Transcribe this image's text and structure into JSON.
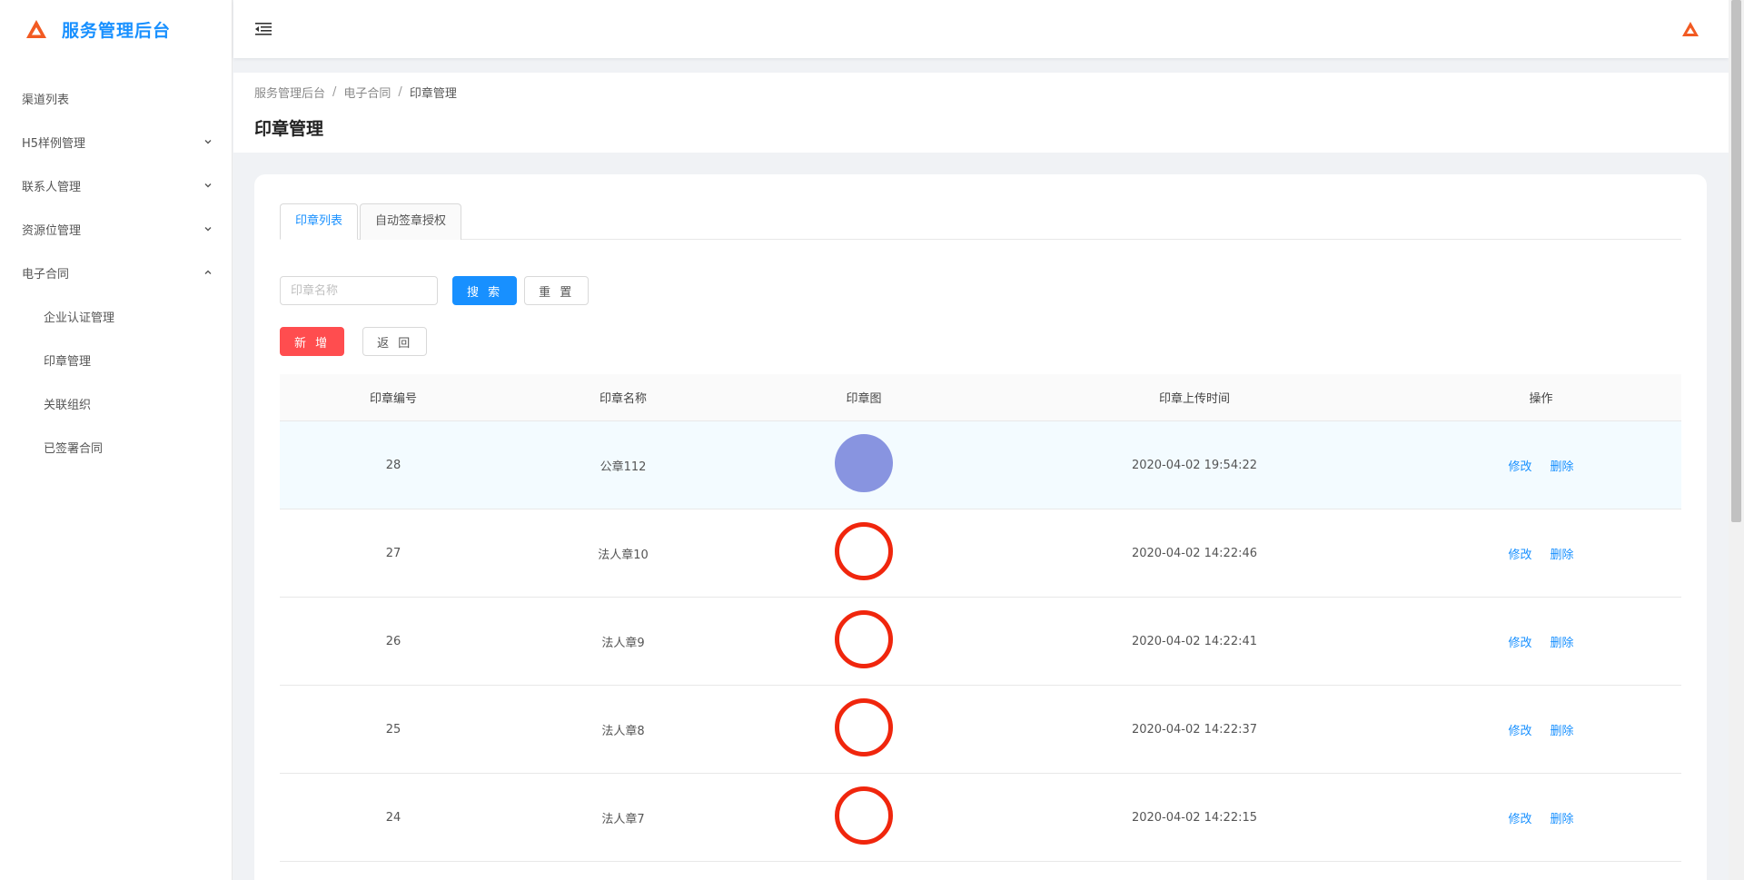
{
  "app": {
    "title": "服务管理后台"
  },
  "sidebar": {
    "items": [
      {
        "label": "渠道列表"
      },
      {
        "label": "H5样例管理"
      },
      {
        "label": "联系人管理"
      },
      {
        "label": "资源位管理"
      },
      {
        "label": "电子合同"
      }
    ],
    "submenu": [
      {
        "label": "企业认证管理"
      },
      {
        "label": "印章管理"
      },
      {
        "label": "关联组织"
      },
      {
        "label": "已签署合同"
      }
    ]
  },
  "breadcrumb": {
    "items": [
      "服务管理后台",
      "电子合同",
      "印章管理"
    ],
    "separator": "/"
  },
  "page": {
    "title": "印章管理"
  },
  "tabs": [
    {
      "label": "印章列表",
      "active": true
    },
    {
      "label": "自动签章授权",
      "active": false
    }
  ],
  "search": {
    "placeholder": "印章名称",
    "value": "",
    "search_label": "搜 索",
    "reset_label": "重 置"
  },
  "actions": {
    "add_label": "新 增",
    "back_label": "返 回"
  },
  "table": {
    "columns": [
      "印章编号",
      "印章名称",
      "印章图",
      "印章上传时间",
      "操作"
    ],
    "rows": [
      {
        "id": "28",
        "name": "公章112",
        "seal": "filled",
        "time": "2020-04-02 19:54:22",
        "edit": "修改",
        "delete": "删除"
      },
      {
        "id": "27",
        "name": "法人章10",
        "seal": "ring",
        "time": "2020-04-02 14:22:46",
        "edit": "修改",
        "delete": "删除"
      },
      {
        "id": "26",
        "name": "法人章9",
        "seal": "ring",
        "time": "2020-04-02 14:22:41",
        "edit": "修改",
        "delete": "删除"
      },
      {
        "id": "25",
        "name": "法人章8",
        "seal": "ring",
        "time": "2020-04-02 14:22:37",
        "edit": "修改",
        "delete": "删除"
      },
      {
        "id": "24",
        "name": "法人章7",
        "seal": "ring",
        "time": "2020-04-02 14:22:15",
        "edit": "修改",
        "delete": "删除"
      }
    ]
  },
  "colors": {
    "primary": "#1890ff",
    "danger": "#ff4d4f",
    "seal_red": "#f0260d",
    "seal_filled": "#8894e0",
    "logo": "#f25a22"
  },
  "icons": {
    "logo": "triangle-logo-icon",
    "fold": "menu-fold-icon",
    "user": "triangle-avatar-icon"
  }
}
